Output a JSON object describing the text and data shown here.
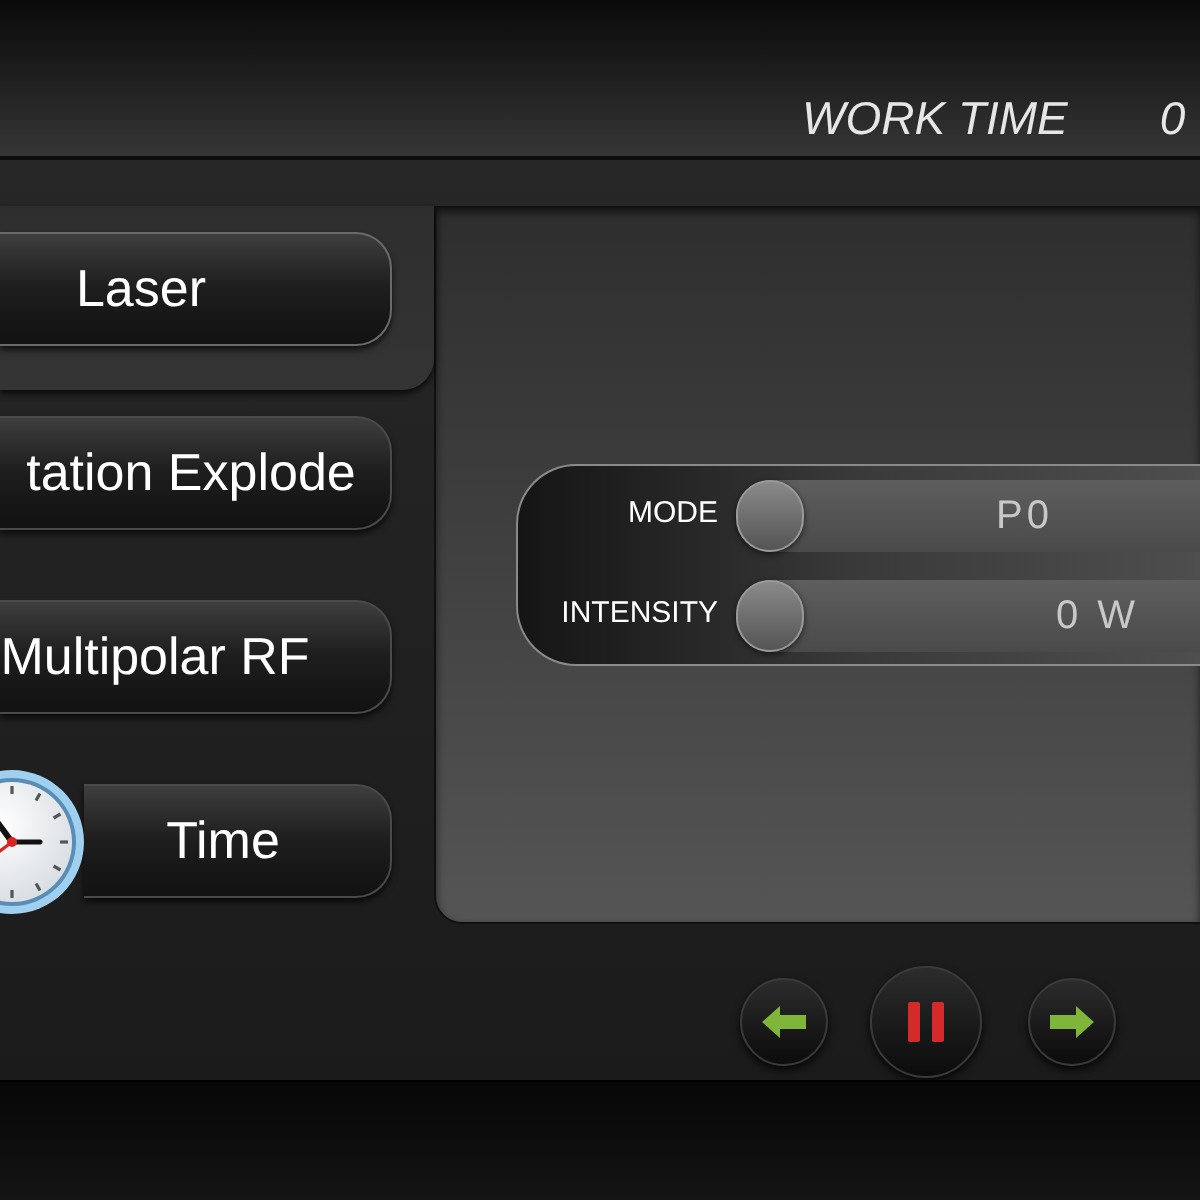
{
  "header": {
    "label": "WORK TIME",
    "value": "0"
  },
  "menu": [
    {
      "label": "Laser",
      "selected": true,
      "kind": "text"
    },
    {
      "label": "tation Explode",
      "selected": false,
      "kind": "text"
    },
    {
      "label": "Multipolar RF",
      "selected": false,
      "kind": "text"
    },
    {
      "label": "Time",
      "selected": false,
      "kind": "clock"
    }
  ],
  "controls": [
    {
      "label": "MODE",
      "value": "P0",
      "level": 0
    },
    {
      "label": "INTENSITY",
      "value": "0 W",
      "level": 0
    }
  ],
  "playback": [
    {
      "kind": "prev"
    },
    {
      "kind": "pause"
    },
    {
      "kind": "next"
    }
  ]
}
